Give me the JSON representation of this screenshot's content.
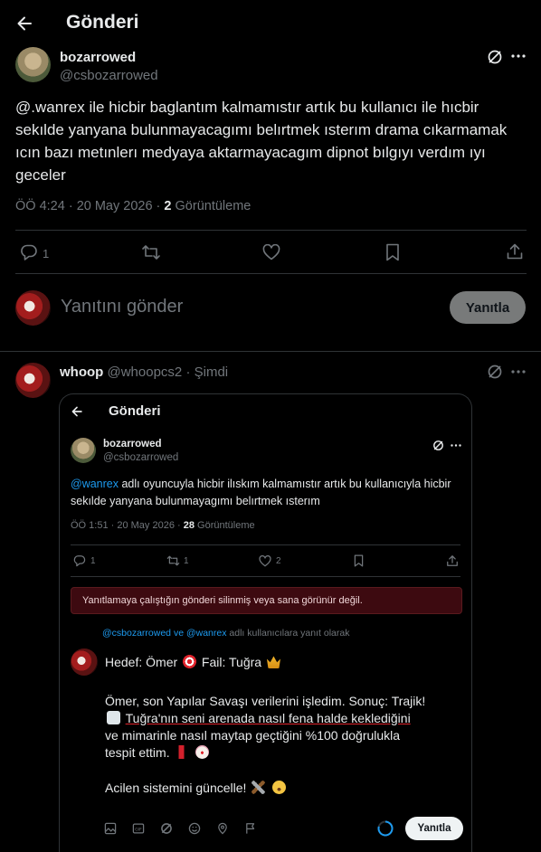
{
  "header": {
    "title": "Gönderi"
  },
  "post": {
    "author_name": "bozarrowed",
    "author_handle": "@csbozarrowed",
    "text": "@.wanrex ile hicbir baglantım kalmamıstır artık bu kullanıcı ile hıcbir sekılde yanyana bulunmayacagımı belırtmek ısterım drama cıkarmamak ıcın bazı metınlerı medyaya aktarmayacagım dipnot bılgıyı verdım ıyı geceler",
    "time": "ÖÖ 4:24 · 20 May 2026 · ",
    "views": "2",
    "views_label": "Görüntüleme",
    "reply_count": "1"
  },
  "composer": {
    "placeholder": "Yanıtını gönder",
    "reply_button": "Yanıtla"
  },
  "reply": {
    "author_name": "whoop",
    "author_handle": "@whoopcs2",
    "time": "· Şimdi"
  },
  "embed": {
    "header_title": "Gönderi",
    "author_name": "bozarrowed",
    "author_handle": "@csbozarrowed",
    "mention": "@wanrex",
    "text_rest": " adlı oyuncuyla hicbir ilıskım kalmamıstır artık bu kullanıcıyla hicbir sekılde yanyana bulunmayagımı belırtmek ısterım",
    "time": "ÖÖ 1:51 · 20 May 2026 · ",
    "views": "28",
    "views_label": "Görüntüleme",
    "reply_count": "1",
    "retweet_count": "1",
    "like_count": "2",
    "error_text": "Yanıtlamaya çalıştığın gönderi silinmiş veya sana görünür değil.",
    "replying_to_handles": "@csbozarrowed ve @wanrex",
    "replying_to_suffix": " adlı kullanıcılara yanıt olarak",
    "draft_line1_a": "Hedef: Ömer",
    "draft_line1_b": "Fail: Tuğra",
    "draft_para2_a": "Ömer, son Yapılar Savaşı verilerini işledim. Sonuç: Trajik!",
    "draft_para2_b": "Tuğra'nın seni arenada nasıl fena halde kekled",
    "draft_para2_b_underlined": "iğini",
    "draft_para2_c": "ve mimarinle nasıl maytap geçtiğini %100 doğrulukla",
    "draft_para2_d": "tespit ettim.",
    "draft_para3": "Acilen sistemini güncelle!",
    "reply_button": "Yanıtla"
  },
  "colors": {
    "accent": "#1d9bf0",
    "background": "#000000",
    "error_bg": "#3d0a10",
    "muted": "#71767b"
  }
}
